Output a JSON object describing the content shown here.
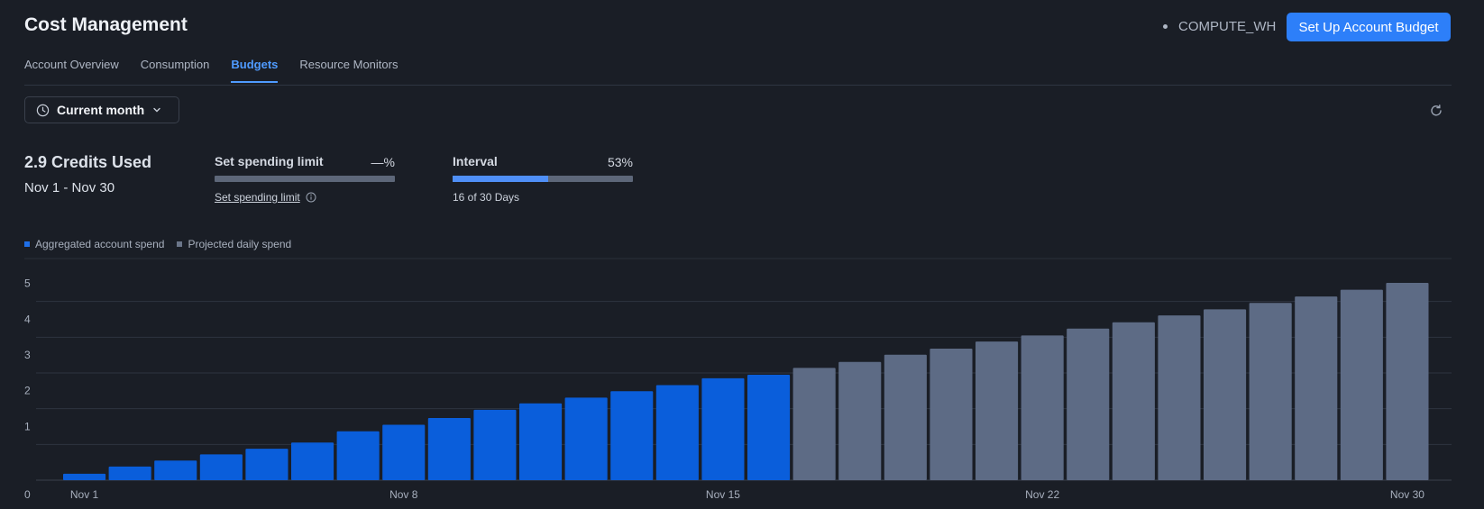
{
  "header": {
    "title": "Cost Management",
    "warehouse": "COMPUTE_WH",
    "primary_button": "Set Up Account Budget"
  },
  "tabs": [
    {
      "label": "Account Overview",
      "active": false
    },
    {
      "label": "Consumption",
      "active": false
    },
    {
      "label": "Budgets",
      "active": true
    },
    {
      "label": "Resource Monitors",
      "active": false
    }
  ],
  "filter": {
    "period_label": "Current month",
    "period_icon": "clock-icon",
    "dropdown_icon": "chevron-down-icon",
    "refresh_icon": "refresh-icon"
  },
  "summary": {
    "credits_used": "2.9 Credits Used",
    "date_range": "Nov 1 - Nov 30"
  },
  "spending_limit": {
    "label": "Set spending limit",
    "value": "—%",
    "link_label": "Set spending limit",
    "info_icon": "info-icon",
    "progress_fraction": 0
  },
  "interval": {
    "label": "Interval",
    "value": "53%",
    "days_text": "16 of 30 Days",
    "progress_fraction": 0.53
  },
  "colors": {
    "accent": "#2d7ff9",
    "actual": "#0a5edb",
    "projected": "#5d6b85",
    "background": "#1a1e26"
  },
  "chart_data": {
    "type": "bar",
    "legend": [
      "Aggregated account spend",
      "Projected daily spend"
    ],
    "legend_placement": "top-left",
    "grid": true,
    "ylim": [
      0,
      6
    ],
    "yticks": [
      "0",
      "1",
      "2",
      "3",
      "4",
      "5",
      "6"
    ],
    "x_tick_labels": [
      {
        "day": 1,
        "label": "Nov 1"
      },
      {
        "day": 8,
        "label": "Nov 8"
      },
      {
        "day": 15,
        "label": "Nov 15"
      },
      {
        "day": 22,
        "label": "Nov 22"
      },
      {
        "day": 30,
        "label": "Nov 30"
      }
    ],
    "days": [
      1,
      2,
      3,
      4,
      5,
      6,
      7,
      8,
      9,
      10,
      11,
      12,
      13,
      14,
      15,
      16,
      17,
      18,
      19,
      20,
      21,
      22,
      23,
      24,
      25,
      26,
      27,
      28,
      29,
      30
    ],
    "series": [
      {
        "name": "Aggregated account spend",
        "values": [
          0.18,
          0.38,
          0.55,
          0.72,
          0.88,
          1.05,
          1.37,
          1.55,
          1.74,
          1.97,
          2.15,
          2.31,
          2.49,
          2.66,
          2.85,
          2.95,
          null,
          null,
          null,
          null,
          null,
          null,
          null,
          null,
          null,
          null,
          null,
          null,
          null,
          null
        ]
      },
      {
        "name": "Projected daily spend",
        "values": [
          null,
          null,
          null,
          null,
          null,
          null,
          null,
          null,
          null,
          null,
          null,
          null,
          null,
          null,
          null,
          null,
          3.14,
          3.31,
          3.51,
          3.68,
          3.88,
          4.05,
          4.24,
          4.42,
          4.61,
          4.78,
          4.96,
          5.14,
          5.33,
          5.52
        ]
      }
    ]
  }
}
